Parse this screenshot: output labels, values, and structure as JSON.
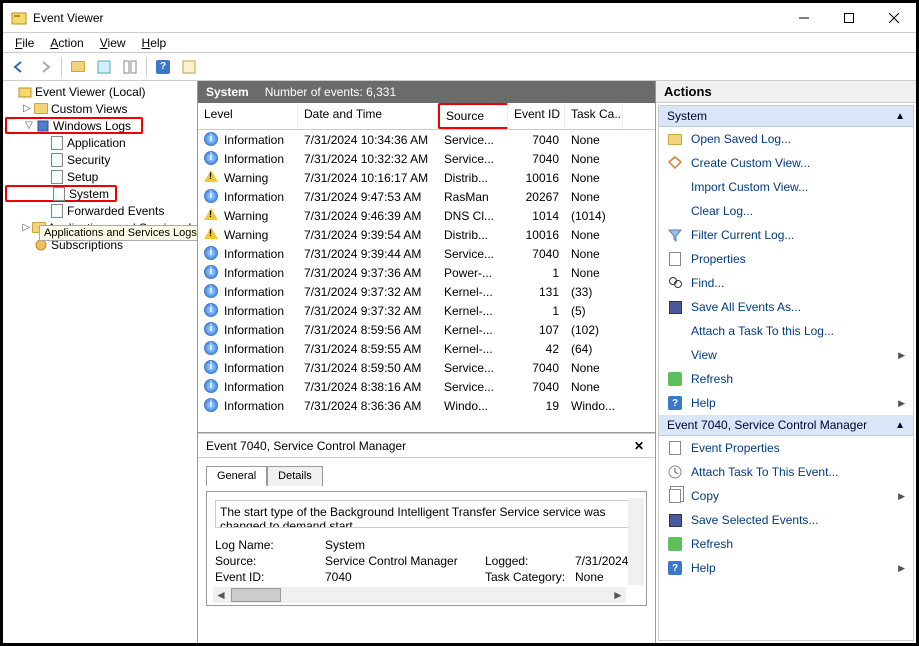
{
  "window": {
    "title": "Event Viewer"
  },
  "menu": {
    "file": "File",
    "action": "Action",
    "view": "View",
    "help": "Help"
  },
  "tree": {
    "root": "Event Viewer (Local)",
    "custom_views": "Custom Views",
    "windows_logs": "Windows Logs",
    "application": "Application",
    "security": "Security",
    "setup": "Setup",
    "system": "System",
    "forwarded": "Forwarded Events",
    "apps_services_short": "Applications and Services L",
    "subscriptions": "Subscriptions",
    "tooltip": "Applications and Services Logs"
  },
  "center": {
    "header_name": "System",
    "header_count": "Number of events: 6,331",
    "columns": {
      "level": "Level",
      "dt": "Date and Time",
      "src": "Source",
      "eid": "Event ID",
      "tc": "Task Ca..."
    },
    "rows": [
      {
        "level": "Information",
        "icon": "info",
        "dt": "7/31/2024 10:34:36 AM",
        "src": "Service...",
        "eid": "7040",
        "tc": "None"
      },
      {
        "level": "Information",
        "icon": "info",
        "dt": "7/31/2024 10:32:32 AM",
        "src": "Service...",
        "eid": "7040",
        "tc": "None"
      },
      {
        "level": "Warning",
        "icon": "warn",
        "dt": "7/31/2024 10:16:17 AM",
        "src": "Distrib...",
        "eid": "10016",
        "tc": "None"
      },
      {
        "level": "Information",
        "icon": "info",
        "dt": "7/31/2024 9:47:53 AM",
        "src": "RasMan",
        "eid": "20267",
        "tc": "None"
      },
      {
        "level": "Warning",
        "icon": "warn",
        "dt": "7/31/2024 9:46:39 AM",
        "src": "DNS Cl...",
        "eid": "1014",
        "tc": "(1014)"
      },
      {
        "level": "Warning",
        "icon": "warn",
        "dt": "7/31/2024 9:39:54 AM",
        "src": "Distrib...",
        "eid": "10016",
        "tc": "None"
      },
      {
        "level": "Information",
        "icon": "info",
        "dt": "7/31/2024 9:39:44 AM",
        "src": "Service...",
        "eid": "7040",
        "tc": "None"
      },
      {
        "level": "Information",
        "icon": "info",
        "dt": "7/31/2024 9:37:36 AM",
        "src": "Power-...",
        "eid": "1",
        "tc": "None"
      },
      {
        "level": "Information",
        "icon": "info",
        "dt": "7/31/2024 9:37:32 AM",
        "src": "Kernel-...",
        "eid": "131",
        "tc": "(33)"
      },
      {
        "level": "Information",
        "icon": "info",
        "dt": "7/31/2024 9:37:32 AM",
        "src": "Kernel-...",
        "eid": "1",
        "tc": "(5)"
      },
      {
        "level": "Information",
        "icon": "info",
        "dt": "7/31/2024 8:59:56 AM",
        "src": "Kernel-...",
        "eid": "107",
        "tc": "(102)"
      },
      {
        "level": "Information",
        "icon": "info",
        "dt": "7/31/2024 8:59:55 AM",
        "src": "Kernel-...",
        "eid": "42",
        "tc": "(64)"
      },
      {
        "level": "Information",
        "icon": "info",
        "dt": "7/31/2024 8:59:50 AM",
        "src": "Service...",
        "eid": "7040",
        "tc": "None"
      },
      {
        "level": "Information",
        "icon": "info",
        "dt": "7/31/2024 8:38:16 AM",
        "src": "Service...",
        "eid": "7040",
        "tc": "None"
      },
      {
        "level": "Information",
        "icon": "info",
        "dt": "7/31/2024 8:36:36 AM",
        "src": "Windo...",
        "eid": "19",
        "tc": "Windo..."
      }
    ]
  },
  "detail": {
    "title": "Event 7040, Service Control Manager",
    "tab_general": "General",
    "tab_details": "Details",
    "desc": "The start type of the Background Intelligent Transfer Service service was changed to demand start.",
    "log_name_l": "Log Name:",
    "log_name_v": "System",
    "source_l": "Source:",
    "source_v": "Service Control Manager",
    "logged_l": "Logged:",
    "logged_v": "7/31/2024",
    "eventid_l": "Event ID:",
    "eventid_v": "7040",
    "taskcat_l": "Task Category:",
    "taskcat_v": "None"
  },
  "actions": {
    "pane_title": "Actions",
    "section1": "System",
    "open_saved": "Open Saved Log...",
    "create_custom": "Create Custom View...",
    "import_custom": "Import Custom View...",
    "clear_log": "Clear Log...",
    "filter_log": "Filter Current Log...",
    "properties": "Properties",
    "find": "Find...",
    "save_all": "Save All Events As...",
    "attach_task": "Attach a Task To this Log...",
    "view": "View",
    "refresh": "Refresh",
    "help": "Help",
    "section2": "Event 7040, Service Control Manager",
    "event_props": "Event Properties",
    "attach_event": "Attach Task To This Event...",
    "copy": "Copy",
    "save_selected": "Save Selected Events...",
    "refresh2": "Refresh",
    "help2": "Help"
  }
}
